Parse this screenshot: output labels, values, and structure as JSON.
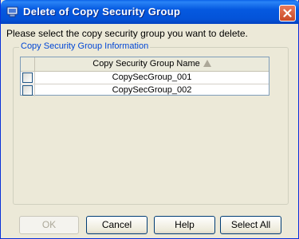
{
  "window": {
    "title": "Delete of Copy Security Group"
  },
  "prompt": "Please select the copy security group you want to delete.",
  "group": {
    "label": "Copy Security Group Information",
    "column_header": "Copy Security Group Name",
    "rows": [
      {
        "name": "CopySecGroup_001",
        "checked": false
      },
      {
        "name": "CopySecGroup_002",
        "checked": false
      }
    ]
  },
  "buttons": {
    "ok": "OK",
    "cancel": "Cancel",
    "help": "Help",
    "select_all": "Select All"
  },
  "colors": {
    "titlebar": "#0453d8",
    "group_label": "#0046d5",
    "background": "#ece9d8"
  }
}
